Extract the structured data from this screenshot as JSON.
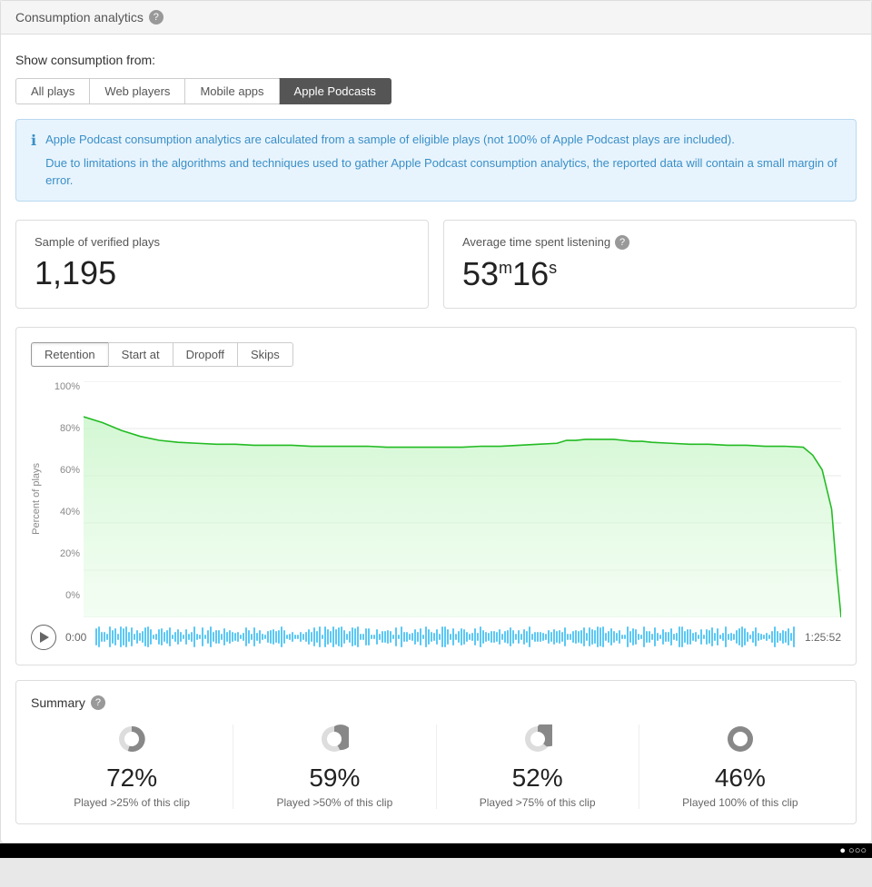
{
  "header": {
    "title": "Consumption analytics",
    "help_icon": "?"
  },
  "show_from": {
    "label": "Show consumption from:",
    "tabs": [
      {
        "id": "all-plays",
        "label": "All plays",
        "active": false
      },
      {
        "id": "web-players",
        "label": "Web players",
        "active": false
      },
      {
        "id": "mobile-apps",
        "label": "Mobile apps",
        "active": false
      },
      {
        "id": "apple-podcasts",
        "label": "Apple Podcasts",
        "active": true
      }
    ]
  },
  "info_box": {
    "line1": "Apple Podcast consumption analytics are calculated from a sample of eligible plays (not 100% of Apple Podcast plays are included).",
    "line2": "Due to limitations in the algorithms and techniques used to gather Apple Podcast consumption analytics, the reported data will contain a small margin of error."
  },
  "stats": {
    "verified_plays": {
      "label": "Sample of verified plays",
      "value": "1,195"
    },
    "avg_time": {
      "label": "Average time spent listening",
      "help": "?",
      "minutes": "53",
      "seconds": "16"
    }
  },
  "chart": {
    "tabs": [
      {
        "id": "retention",
        "label": "Retention",
        "active": true
      },
      {
        "id": "start-at",
        "label": "Start at",
        "active": false
      },
      {
        "id": "dropoff",
        "label": "Dropoff",
        "active": false
      },
      {
        "id": "skips",
        "label": "Skips",
        "active": false
      }
    ],
    "y_axis_label": "Percent of plays",
    "y_ticks": [
      "100%",
      "80%",
      "60%",
      "40%",
      "20%",
      "0%"
    ],
    "time_start": "0:00",
    "time_end": "1:25:52"
  },
  "summary": {
    "title": "Summary",
    "help": "?",
    "items": [
      {
        "percent": "72%",
        "desc": "Played >25% of this clip",
        "fill": 0.72
      },
      {
        "percent": "59%",
        "desc": "Played >50% of this clip",
        "fill": 0.59
      },
      {
        "percent": "52%",
        "desc": "Played >75% of this clip",
        "fill": 0.52
      },
      {
        "percent": "46%",
        "desc": "Played 100% of this clip",
        "fill": 0.46
      }
    ]
  },
  "bottom_bar": {
    "text": "● ○○○"
  }
}
